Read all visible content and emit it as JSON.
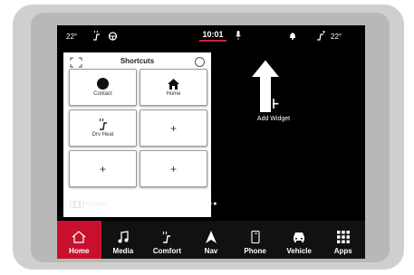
{
  "status_bar": {
    "outside_temp": "22°",
    "time": "10:01",
    "cabin_temp": "22°",
    "icons": [
      "seat-heat-icon",
      "steering-heat-icon",
      "microphone-icon",
      "notification-icon",
      "climate-icon"
    ],
    "accent_color": "#d0203a"
  },
  "shortcuts": {
    "title": "Shortcuts",
    "tiles": [
      {
        "label": "Contact",
        "icon": "contact-dot-icon"
      },
      {
        "label": "Home",
        "icon": "home-icon"
      },
      {
        "label": "Drv Heat",
        "icon": "seat-heat-icon"
      },
      {
        "label": "",
        "icon": "plus-icon"
      },
      {
        "label": "",
        "icon": "plus-icon"
      },
      {
        "label": "",
        "icon": "plus-icon"
      }
    ],
    "plus": "+"
  },
  "widget": {
    "plus": "+",
    "label": "Add Widget"
  },
  "footer": {
    "my_pages": "MyPages"
  },
  "nav": {
    "active_color": "#c8102e",
    "items": [
      {
        "label": "Home",
        "icon": "home-icon"
      },
      {
        "label": "Media",
        "icon": "music-note-icon"
      },
      {
        "label": "Comfort",
        "icon": "seat-heat-icon"
      },
      {
        "label": "Nav",
        "icon": "navigation-arrow-icon"
      },
      {
        "label": "Phone",
        "icon": "phone-icon"
      },
      {
        "label": "Vehicle",
        "icon": "car-icon"
      },
      {
        "label": "Apps",
        "icon": "apps-grid-icon"
      }
    ]
  }
}
